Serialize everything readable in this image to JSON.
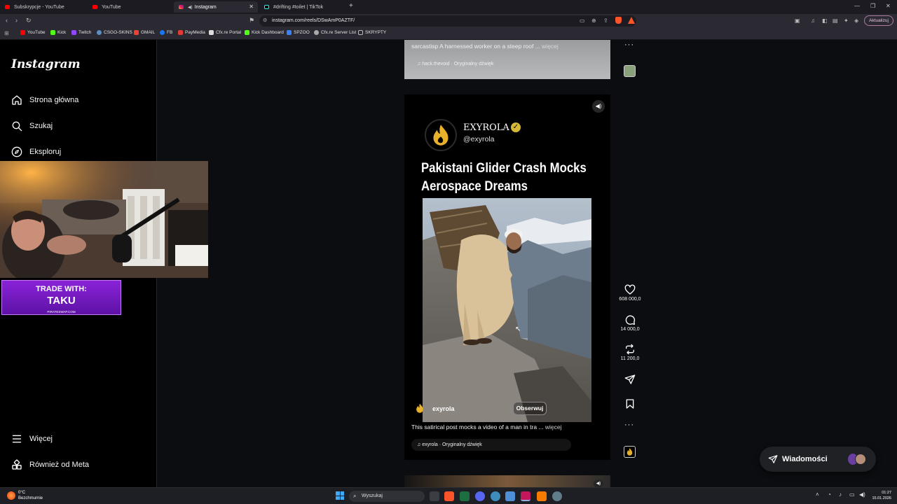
{
  "tabs": [
    {
      "label": "Subskrypcje - YouTube",
      "icon": "youtube-icon"
    },
    {
      "label": "YouTube",
      "icon": "youtube-icon"
    },
    {
      "label": "Instagram",
      "icon": "instagram-icon",
      "active": true
    },
    {
      "label": "#drifting #toilet | TikTok",
      "icon": "tiktok-icon"
    }
  ],
  "url": "instagram.com/reels/DSwAmP0AZTF/",
  "update_button": "Aktualizuj",
  "bookmarks": [
    "YouTube",
    "Kick",
    "Twitch",
    "CSGO-SKINS",
    "GMAIL",
    "FB",
    "PayMedia",
    "Cfx.re Portal",
    "Kick Dashboard",
    "SPZOO",
    "Cfx.re Server List",
    "SKRYPTY"
  ],
  "instagram": {
    "logo": "Instagram",
    "nav": {
      "home": "Strona główna",
      "search": "Szukaj",
      "explore": "Eksploruj",
      "more": "Więcej",
      "meta": "Również od Meta"
    }
  },
  "promo": {
    "line1": "TRADE WITH:",
    "line2": "TAKU",
    "line3": "PIRATESWAP.COM"
  },
  "prev_reel": {
    "caption": "sarcastisp A harnessed worker on a steep roof ...",
    "more": "więcej",
    "audio": "hack.thevoid · Oryginalny dźwięk"
  },
  "reel": {
    "account_name": "EXYROLA",
    "handle": "@exyrola",
    "headline_line1": "Pakistani Glider Crash Mocks",
    "headline_line2": "Aerospace Dreams",
    "username": "exyrola",
    "follow_button": "Obserwuj",
    "caption": "This satirical post mocks a video of a man in tra ...",
    "more": "więcej",
    "audio": "exyrola · Oryginalny dźwięk"
  },
  "actions": {
    "likes": "608 000,0",
    "comments": "14 000,0",
    "reposts": "11 200,0"
  },
  "messages_label": "Wiadomości",
  "taskbar": {
    "weather_temp": "0°C",
    "weather_text": "Bezchmurnie",
    "search_placeholder": "Wyszukaj",
    "time": "01:27",
    "date": "15.01.2026"
  },
  "colors": {
    "accent_verified": "#d6b738",
    "promo_purple": "#7a1fd0",
    "brave_orange": "#fb542b"
  }
}
